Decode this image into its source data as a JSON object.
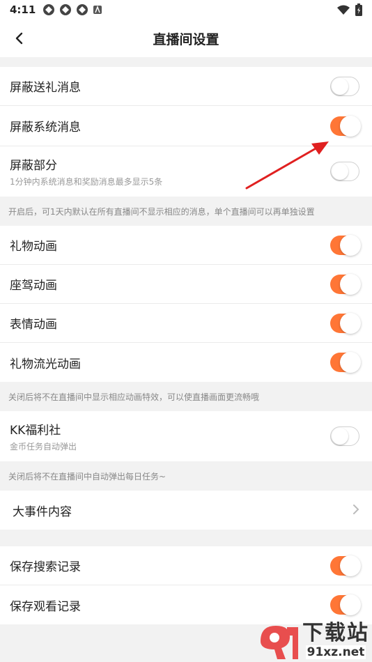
{
  "status_bar": {
    "time": "4:11",
    "icons": [
      "notification-icon",
      "notification-icon",
      "notification-icon",
      "app-icon"
    ],
    "right_icons": [
      "wifi-icon",
      "battery-icon"
    ]
  },
  "header": {
    "title": "直播间设置",
    "back_icon": "chevron-left-icon"
  },
  "colors": {
    "accent": "#ff7636",
    "background": "#f2f2f2",
    "annotation_arrow": "#e02020"
  },
  "section1": {
    "rows": [
      {
        "label": "屏蔽送礼消息",
        "toggle": "off"
      },
      {
        "label": "屏蔽系统消息",
        "toggle": "on"
      },
      {
        "label": "屏蔽部分",
        "sub": "1分钟内系统消息和奖励消息最多显示5条",
        "toggle": "off"
      }
    ],
    "note": "开启后，可1天内默认在所有直播间不显示相应的消息，单个直播间可以再单独设置"
  },
  "section2": {
    "rows": [
      {
        "label": "礼物动画",
        "toggle": "on"
      },
      {
        "label": "座驾动画",
        "toggle": "on"
      },
      {
        "label": "表情动画",
        "toggle": "on"
      },
      {
        "label": "礼物流光动画",
        "toggle": "on"
      }
    ],
    "note": "关闭后将不在直播间中显示相应动画特效，可以使直播画面更流畅哦"
  },
  "section3": {
    "row": {
      "label": "KK福利社",
      "sub": "金币任务自动弹出",
      "toggle": "off"
    },
    "note": "关闭后将不在直播间中自动弹出每日任务~"
  },
  "section4": {
    "row": {
      "label": "大事件内容"
    }
  },
  "section5": {
    "rows": [
      {
        "label": "保存搜索记录",
        "toggle": "on"
      },
      {
        "label": "保存观看记录",
        "toggle": "on"
      }
    ]
  },
  "watermark": {
    "big": "下载站",
    "small": "91xz.net"
  }
}
